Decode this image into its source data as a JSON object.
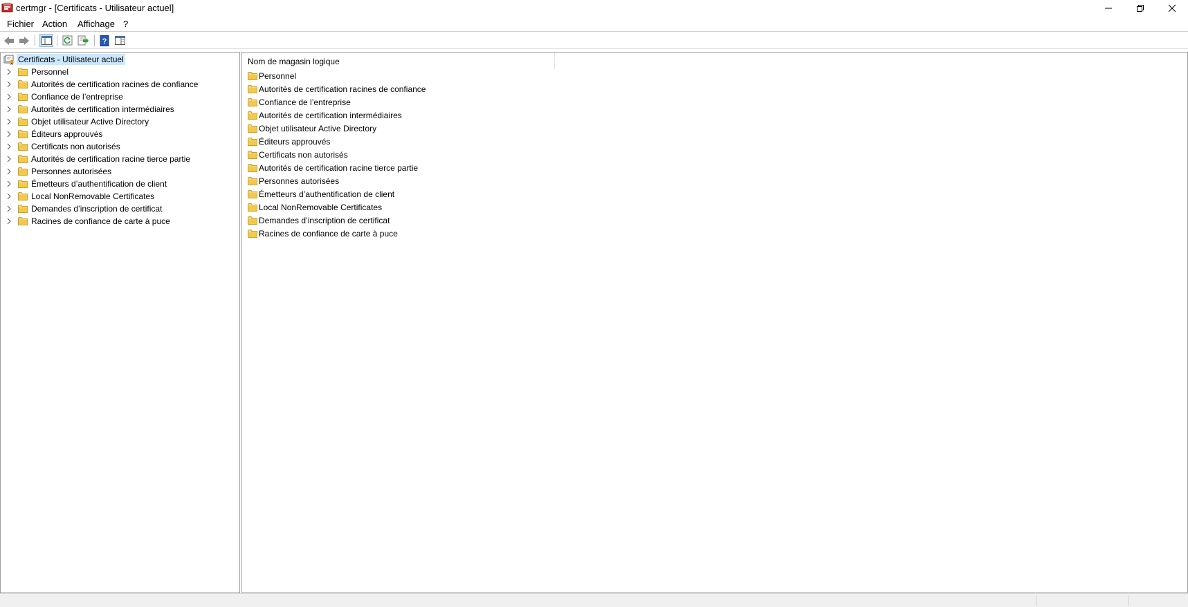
{
  "window": {
    "title": "certmgr - [Certificats - Utilisateur actuel]",
    "icon": "certmgr-app-icon"
  },
  "menu": [
    "Fichier",
    "Action",
    "Affichage",
    "?"
  ],
  "toolbar": {
    "buttons": [
      "back-arrow-icon",
      "forward-arrow-icon",
      "show-hide-console-tree-icon",
      "refresh-icon",
      "export-list-icon",
      "help-icon",
      "show-hide-action-pane-icon"
    ]
  },
  "tree": {
    "root": "Certificats - Utilisateur actuel",
    "items": [
      "Personnel",
      "Autorités de certification racines de confiance",
      "Confiance de l’entreprise",
      "Autorités de certification intermédiaires",
      "Objet utilisateur Active Directory",
      "Éditeurs approuvés",
      "Certificats non autorisés",
      "Autorités de certification racine tierce partie",
      "Personnes autorisées",
      "Émetteurs d’authentification de client",
      "Local NonRemovable Certificates",
      "Demandes d’inscription de certificat",
      "Racines de confiance de carte à puce"
    ]
  },
  "list": {
    "column_header": "Nom de magasin logique",
    "items": [
      "Personnel",
      "Autorités de certification racines de confiance",
      "Confiance de l’entreprise",
      "Autorités de certification intermédiaires",
      "Objet utilisateur Active Directory",
      "Éditeurs approuvés",
      "Certificats non autorisés",
      "Autorités de certification racine tierce partie",
      "Personnes autorisées",
      "Émetteurs d’authentification de client",
      "Local NonRemovable Certificates",
      "Demandes d’inscription de certificat",
      "Racines de confiance de carte à puce"
    ]
  },
  "colors": {
    "selection": "#cce8ff",
    "folder": "#f2c94c",
    "accent": "#0078d7"
  }
}
